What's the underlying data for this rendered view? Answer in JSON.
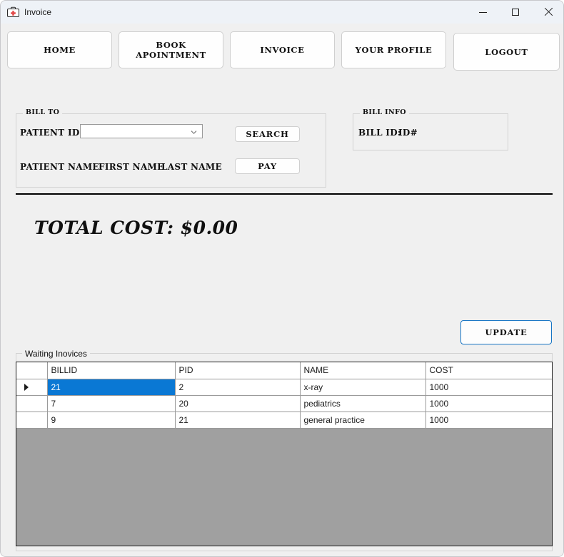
{
  "window": {
    "title": "Invoice",
    "icon": "medical-kit-icon",
    "controls": {
      "minimize": "minimize-icon",
      "maximize": "maximize-icon",
      "close": "close-icon"
    }
  },
  "nav": {
    "items": [
      {
        "label": "HOME",
        "name": "nav-home"
      },
      {
        "label": "BOOK APOINTMENT",
        "name": "nav-book-appointment"
      },
      {
        "label": "INVOICE",
        "name": "nav-invoice"
      },
      {
        "label": "YOUR PROFILE",
        "name": "nav-your-profile"
      },
      {
        "label": "LOGOUT",
        "name": "nav-logout"
      }
    ]
  },
  "bill_to": {
    "group_label": "BILL TO",
    "patient_id_label": "PATIENT ID:",
    "patient_id_value": "",
    "patient_id_placeholder": "",
    "patient_name_label": "PATIENT NAME:",
    "first_name": "FIRST NAME",
    "last_name": "LAST NAME",
    "search_label": "SEARCH",
    "pay_label": "PAY"
  },
  "bill_info": {
    "group_label": "BILL INFO",
    "bill_id_label": "BILL ID:",
    "bill_id_value": "ID#"
  },
  "summary": {
    "total_cost": "TOTAL COST:  $0.00"
  },
  "actions": {
    "update_label": "UPDATE"
  },
  "grid": {
    "group_label": "Waiting Inovices",
    "columns": [
      "BILLID",
      "PID",
      "NAME",
      "COST"
    ],
    "rows": [
      {
        "billid": "21",
        "pid": "2",
        "name": "x-ray",
        "cost": "1000",
        "selected": true,
        "current": true
      },
      {
        "billid": "7",
        "pid": "20",
        "name": "pediatrics",
        "cost": "1000",
        "selected": false,
        "current": false
      },
      {
        "billid": "9",
        "pid": "21",
        "name": "general practice",
        "cost": "1000",
        "selected": false,
        "current": false
      }
    ]
  },
  "colors": {
    "selection": "#0a78d4",
    "focus_border": "#1775c4",
    "grid_filler": "#a0a0a0",
    "window_background": "#f0f0f0",
    "titlebar": "#eef2f7"
  }
}
